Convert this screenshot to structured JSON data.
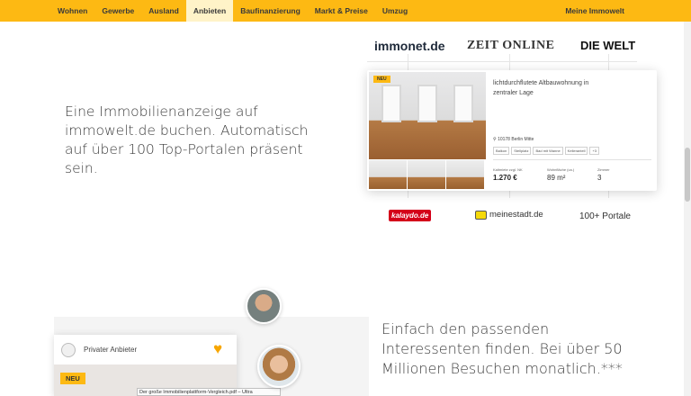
{
  "nav": {
    "items": [
      {
        "label": "Wohnen"
      },
      {
        "label": "Gewerbe"
      },
      {
        "label": "Ausland"
      },
      {
        "label": "Anbieten",
        "active": true
      },
      {
        "label": "Baufinanzierung"
      },
      {
        "label": "Markt & Preise"
      },
      {
        "label": "Umzug"
      }
    ],
    "account_label": "Meine Immowelt",
    "accent_color": "#fdb913"
  },
  "section1": {
    "headline": "Eine Immobilienanzeige auf immowelt.de buchen. Automatisch auf über 100 Top-Portalen präsent sein.",
    "logos_top": [
      "immonet.de",
      "ZEIT ONLINE",
      "DIE WELT"
    ],
    "logos_bottom": [
      "kalaydo.de",
      "meinestadt.de",
      "100+ Portale"
    ],
    "listing": {
      "badge": "NEU",
      "title": "lichtdurchflutete Altbauwohnung in zentraler Lage",
      "location": "10178 Berlin Mitte",
      "tags": [
        "Balkon",
        "Stellplatz",
        "Bad mit Wanne",
        "Kellerantell",
        "+3"
      ],
      "rent_label": "Kaltmiete zzgl. NK",
      "rent_value": "1.270 €",
      "area_label": "Wohnfläche (ca.)",
      "area_value": "89 m²",
      "rooms_label": "Zimmer",
      "rooms_value": "3"
    }
  },
  "section2": {
    "headline": "Einfach den passenden Interessenten finden. Bei über 50 Millionen Besuchen monatlich.***",
    "card": {
      "provider_label": "Privater Anbieter",
      "badge": "NEU",
      "tooltip": "Der große Immobilienplattform-Vergleich.pdf – Ultra"
    }
  }
}
